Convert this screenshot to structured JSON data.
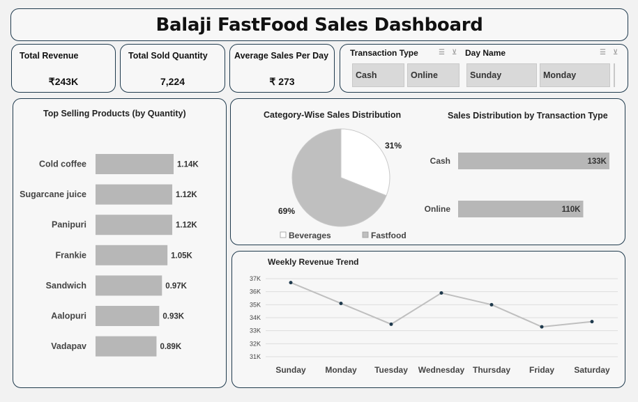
{
  "dashboard": {
    "title": "Balaji FastFood Sales Dashboard"
  },
  "kpis": [
    {
      "label": "Total Revenue",
      "value": "₹243K"
    },
    {
      "label": "Total Sold Quantity",
      "value": "7,224"
    },
    {
      "label": "Average Sales Per Day",
      "value": "₹ 273"
    }
  ],
  "slicers": {
    "transaction_type": {
      "title": "Transaction Type",
      "options": [
        "Cash",
        "Online"
      ]
    },
    "day_name": {
      "title": "Day Name",
      "options": [
        "Sunday",
        "Monday"
      ]
    },
    "icons": [
      "multi-select-icon",
      "clear-filter-icon"
    ]
  },
  "chart_data": [
    {
      "type": "bar",
      "orientation": "horizontal",
      "title": "Top Selling Products (by Quantity)",
      "categories": [
        "Cold coffee",
        "Sugarcane juice",
        "Panipuri",
        "Frankie",
        "Sandwich",
        "Aalopuri",
        "Vadapav"
      ],
      "values": [
        1140,
        1120,
        1120,
        1050,
        970,
        930,
        890
      ],
      "data_labels": [
        "1.14K",
        "1.12K",
        "1.12K",
        "1.05K",
        "0.97K",
        "0.93K",
        "0.89K"
      ],
      "bar_color": "#b7b7b7"
    },
    {
      "type": "pie",
      "title": "Category-Wise Sales Distribution",
      "categories": [
        "Beverages",
        "Fastfood"
      ],
      "values": [
        31,
        69
      ],
      "data_labels": [
        "31%",
        "69%"
      ],
      "colors": [
        "#ffffff",
        "#bfbfbf"
      ],
      "legend": "bottom"
    },
    {
      "type": "bar",
      "orientation": "horizontal",
      "title": "Sales Distribution by Transaction Type",
      "categories": [
        "Cash",
        "Online"
      ],
      "values": [
        133,
        110
      ],
      "data_labels": [
        "133K",
        "110K"
      ],
      "bar_color": "#b7b7b7"
    },
    {
      "type": "line",
      "title": "Weekly Revenue Trend",
      "categories": [
        "Sunday",
        "Monday",
        "Tuesday",
        "Wednesday",
        "Thursday",
        "Friday",
        "Saturday"
      ],
      "values": [
        36.7,
        35.1,
        33.5,
        35.9,
        35.0,
        33.3,
        33.7
      ],
      "ylim": [
        31,
        37
      ],
      "yticks": [
        "31K",
        "32K",
        "33K",
        "34K",
        "35K",
        "36K",
        "37K"
      ],
      "grid": true,
      "line_color": "#bfbfbf",
      "marker_color": "#1f3a4d"
    }
  ]
}
